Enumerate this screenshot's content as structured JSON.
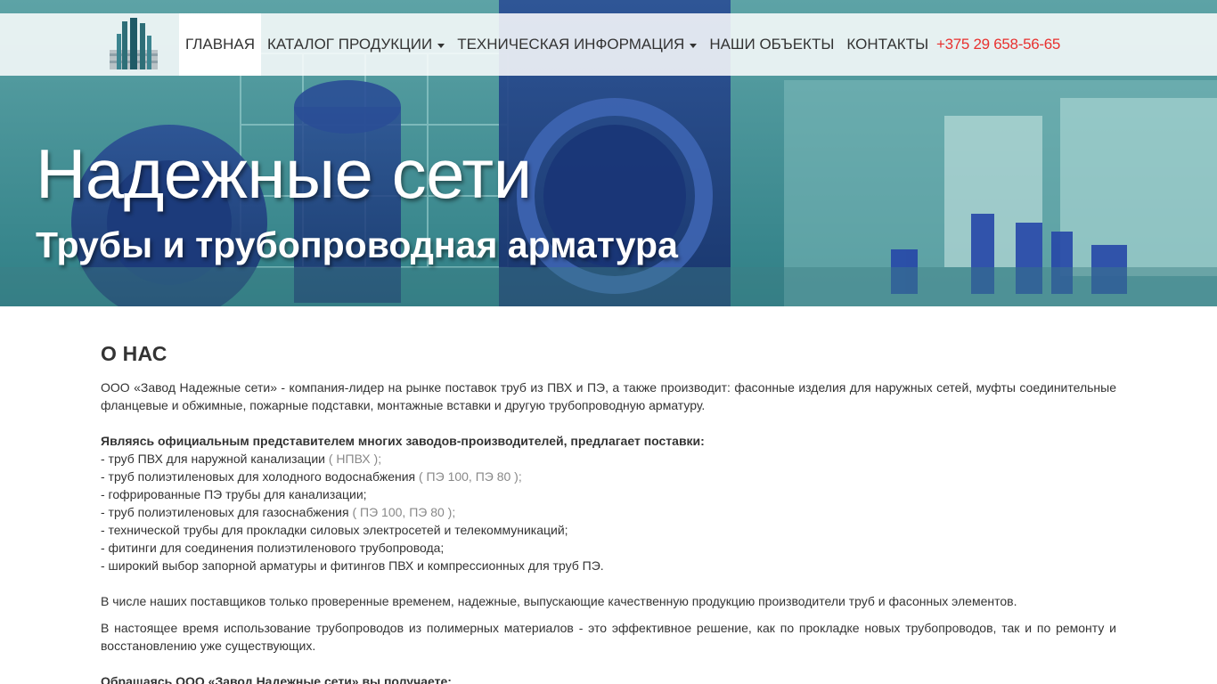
{
  "colors": {
    "accent_phone": "#e8312f",
    "hero_tint": "#2c7c83",
    "text": "#333333"
  },
  "nav": {
    "logo_icon": "factory-logo-icon",
    "items": [
      {
        "label": "ГЛАВНАЯ",
        "active": true,
        "dropdown": false
      },
      {
        "label": "КАТАЛОГ ПРОДУКЦИИ",
        "active": false,
        "dropdown": true
      },
      {
        "label": "ТЕХНИЧЕСКАЯ ИНФОРМАЦИЯ",
        "active": false,
        "dropdown": true
      },
      {
        "label": "НАШИ ОБЪЕКТЫ",
        "active": false,
        "dropdown": false
      },
      {
        "label": "КОНТАКТЫ",
        "active": false,
        "dropdown": false
      }
    ],
    "phone": "+375 29 658-56-65"
  },
  "hero": {
    "title": "Надежные сети",
    "subtitle": "Трубы и трубопроводная арматура"
  },
  "about": {
    "title": "О НАС",
    "intro": "ООО «Завод Надежные сети» - компания-лидер на рынке поставок труб из ПВХ и ПЭ, а также производит: фасонные изделия для наружных сетей, муфты соединительные фланцевые и обжимные, пожарные подставки, монтажные вставки и другую трубопроводную арматуру.",
    "list_heading": "Являясь официальным представителем многих заводов-производителей, предлагает поставки:",
    "list": [
      {
        "text": "- труб ПВХ для наружной канализации ",
        "note": "( НПВХ );"
      },
      {
        "text": "- труб полиэтиленовых для холодного водоснабжения ",
        "note": "( ПЭ 100, ПЭ 80 );"
      },
      {
        "text": "- гофрированные ПЭ трубы для канализации;",
        "note": ""
      },
      {
        "text": "- труб полиэтиленовых для газоснабжения ",
        "note": "( ПЭ 100, ПЭ 80 );"
      },
      {
        "text": "- технической трубы для прокладки силовых электросетей и телекоммуникаций;",
        "note": ""
      },
      {
        "text": "- фитинги для соединения полиэтиленового трубопровода;",
        "note": ""
      },
      {
        "text": "- широкий выбор запорной арматуры и фитингов ПВХ и компрессионных для труб ПЭ.",
        "note": ""
      }
    ],
    "suppliers": "В числе наших поставщиков только проверенные временем, надежные, выпускающие качественную продукцию производители труб и фасонных элементов.",
    "current": "В настоящее время использование трубопроводов из полимерных материалов - это эффективное решение, как по прокладке новых трубопроводов, так и по ремонту и восстановлению уже существующих.",
    "benefits_heading": "Обращаясь ООО «Завод Надежные сети» вы получаете:"
  }
}
